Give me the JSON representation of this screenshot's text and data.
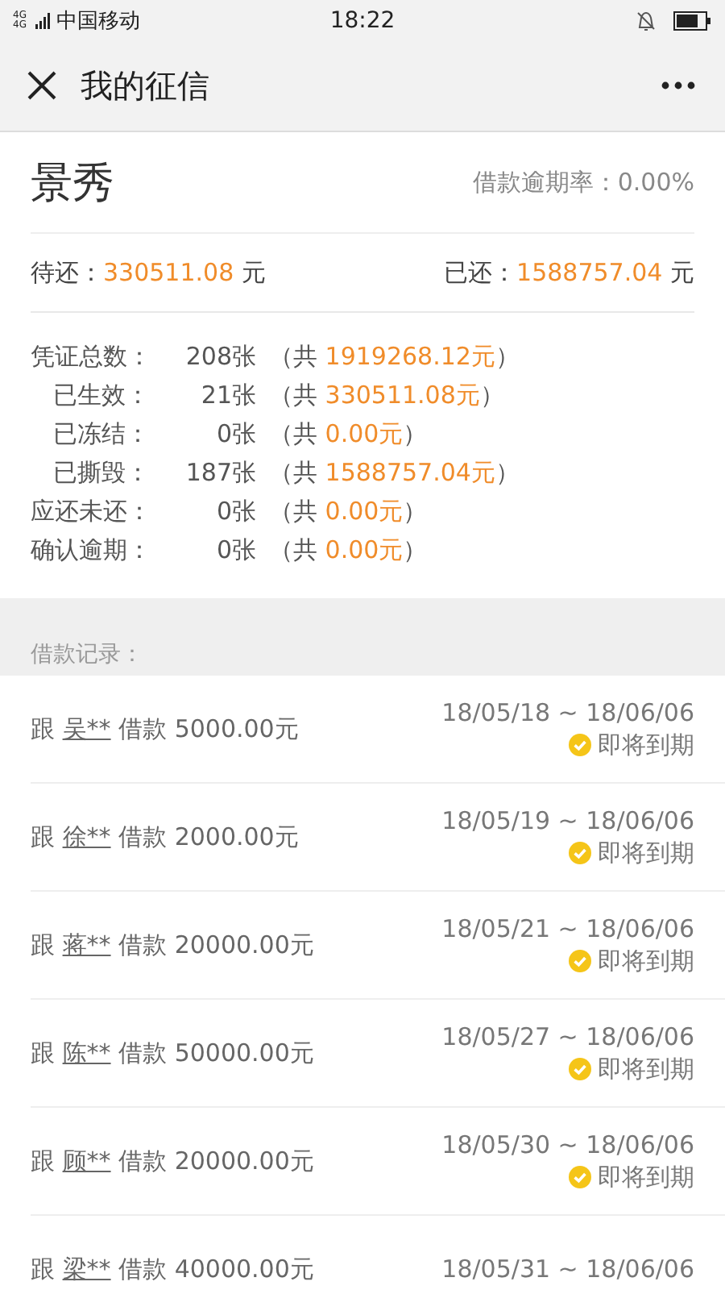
{
  "status_bar": {
    "network": "4G 4G",
    "carrier": "中国移动",
    "time": "18:22"
  },
  "nav": {
    "title": "我的征信"
  },
  "summary": {
    "name": "景秀",
    "overdue_rate_label": "借款逾期率：",
    "overdue_rate": "0.00%"
  },
  "balances": [
    {
      "label": "待还：",
      "amount": "330511.08",
      "unit": "元"
    },
    {
      "label": "已还：",
      "amount": "1588757.04",
      "unit": "元"
    }
  ],
  "stats": [
    {
      "label": "凭证总数：",
      "count": "208张",
      "open": "（共",
      "amount": "1919268.12元",
      "close": "）"
    },
    {
      "label": "已生效：",
      "count": "21张",
      "open": "（共",
      "amount": "330511.08元",
      "close": "）"
    },
    {
      "label": "已冻结：",
      "count": "0张",
      "open": "（共",
      "amount": "0.00元",
      "close": "）"
    },
    {
      "label": "已撕毁：",
      "count": "187张",
      "open": "（共",
      "amount": "1588757.04元",
      "close": "）"
    },
    {
      "label": "应还未还：",
      "count": "0张",
      "open": "（共",
      "amount": "0.00元",
      "close": "）"
    },
    {
      "label": "确认逾期：",
      "count": "0张",
      "open": "（共",
      "amount": "0.00元",
      "close": "）"
    }
  ],
  "records_label": "借款记录：",
  "records": [
    {
      "prefix": "跟",
      "lender": "吴**",
      "loan": "借款 5000.00元",
      "period": "18/05/18 ~ 18/06/06",
      "status": "即将到期"
    },
    {
      "prefix": "跟",
      "lender": "徐**",
      "loan": "借款 2000.00元",
      "period": "18/05/19 ~ 18/06/06",
      "status": "即将到期"
    },
    {
      "prefix": "跟",
      "lender": "蒋**",
      "loan": "借款 20000.00元",
      "period": "18/05/21 ~ 18/06/06",
      "status": "即将到期"
    },
    {
      "prefix": "跟",
      "lender": "陈**",
      "loan": "借款 50000.00元",
      "period": "18/05/27 ~ 18/06/06",
      "status": "即将到期"
    },
    {
      "prefix": "跟",
      "lender": "顾**",
      "loan": "借款 20000.00元",
      "period": "18/05/30 ~ 18/06/06",
      "status": "即将到期"
    },
    {
      "prefix": "跟",
      "lender": "梁**",
      "loan": "借款 40000.00元",
      "period": "18/05/31 ~ 18/06/06"
    }
  ]
}
